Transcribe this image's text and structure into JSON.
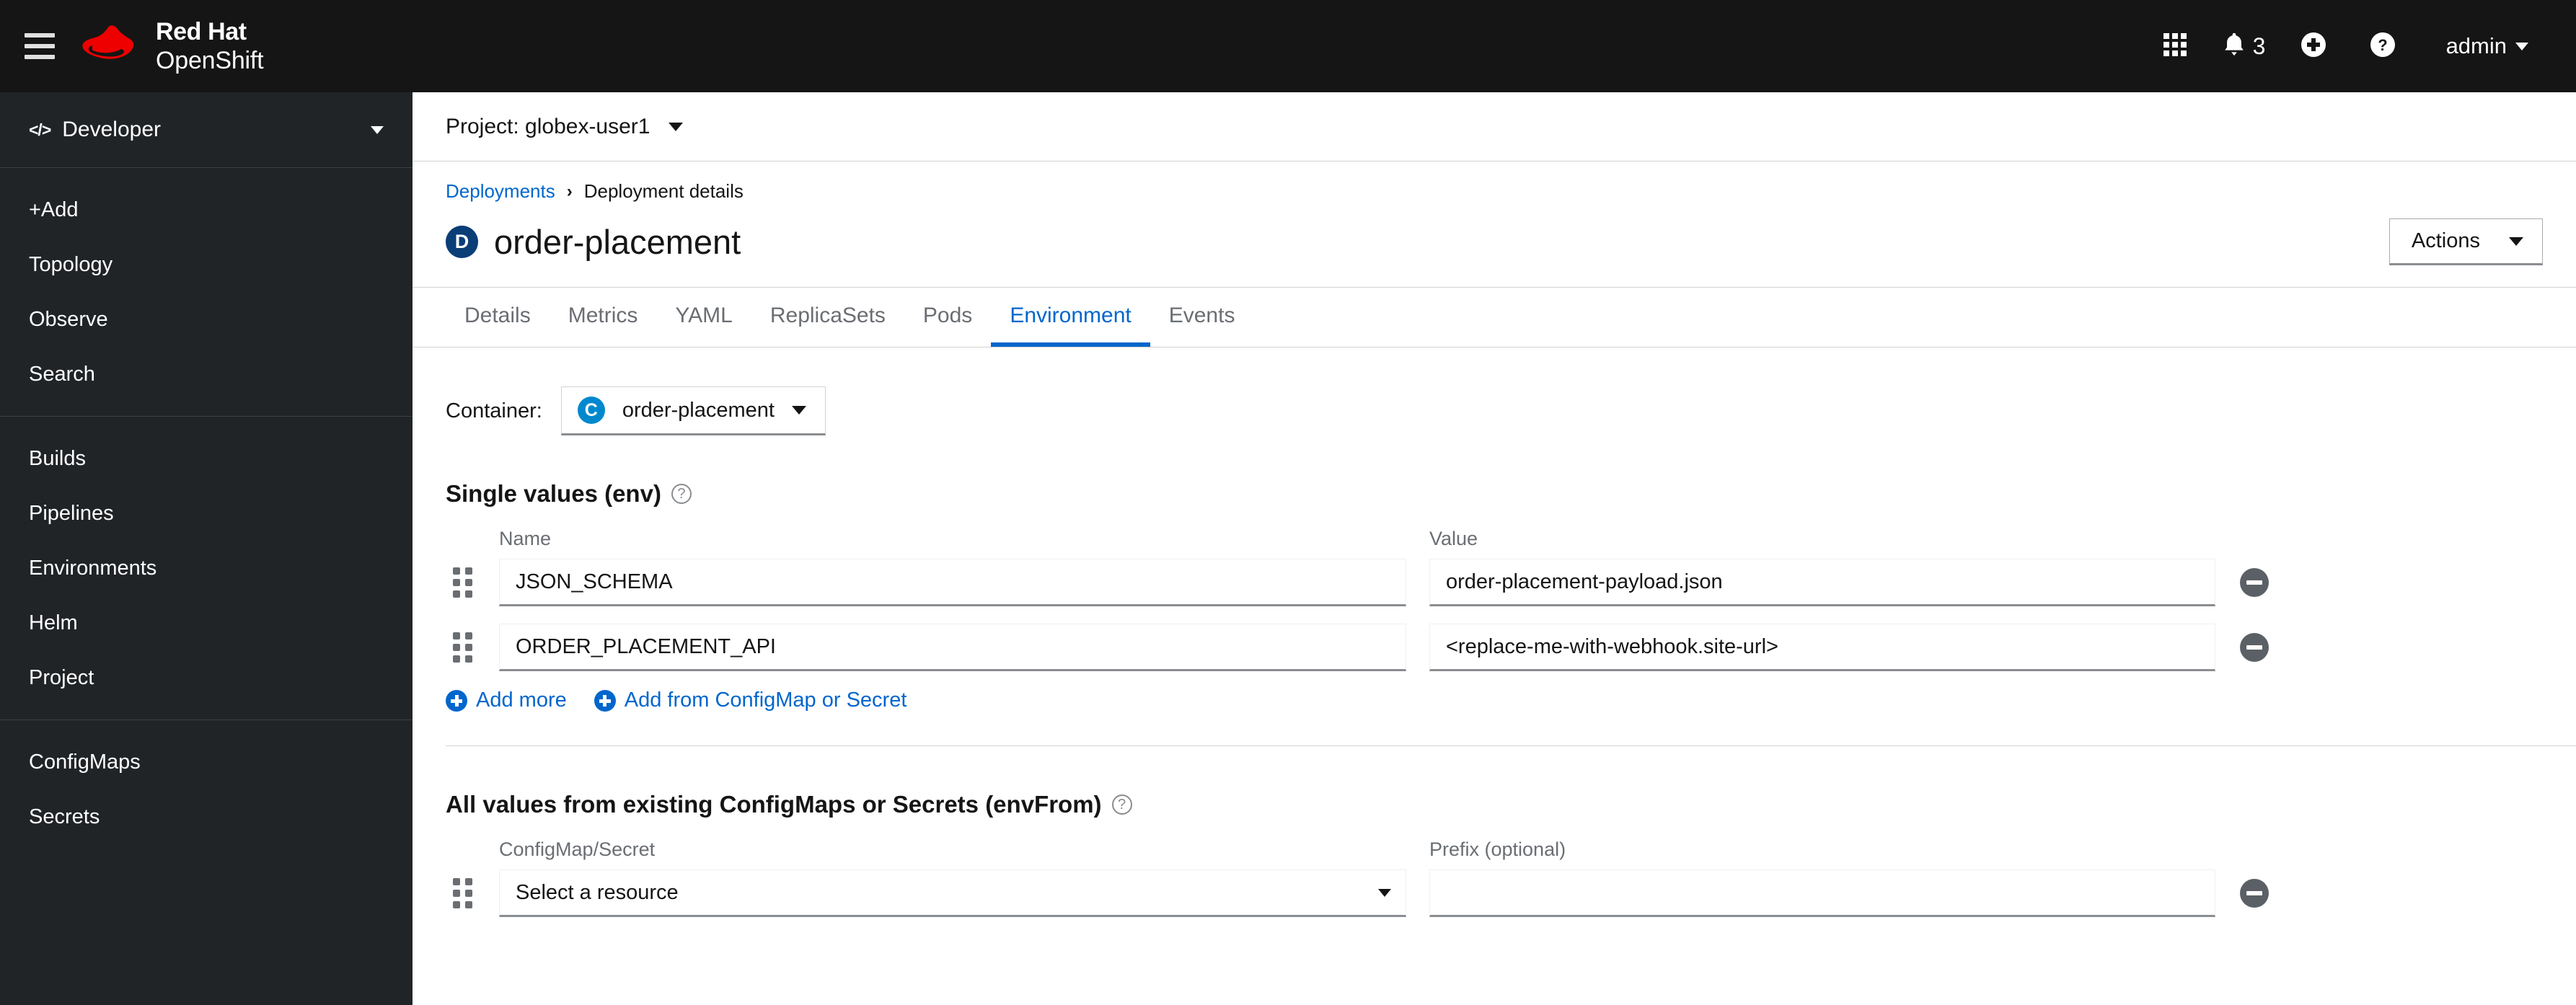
{
  "masthead": {
    "hamburger_name": "navigation-toggle",
    "brand_line1": "Red Hat",
    "brand_line2": "OpenShift",
    "app_launcher_icon": "grid-icon",
    "notification_icon": "bell-icon",
    "notification_count": "3",
    "add_icon": "plus-circle-icon",
    "help_icon": "question-circle-icon",
    "user_name": "admin"
  },
  "sidebar": {
    "perspective": {
      "icon": "code-icon",
      "label": "Developer"
    },
    "groups": [
      {
        "items": [
          {
            "label": "+Add"
          },
          {
            "label": "Topology"
          },
          {
            "label": "Observe"
          },
          {
            "label": "Search"
          }
        ]
      },
      {
        "items": [
          {
            "label": "Builds"
          },
          {
            "label": "Pipelines"
          },
          {
            "label": "Environments"
          },
          {
            "label": "Helm"
          },
          {
            "label": "Project"
          }
        ]
      },
      {
        "items": [
          {
            "label": "ConfigMaps"
          },
          {
            "label": "Secrets"
          }
        ]
      }
    ]
  },
  "project_bar": {
    "label": "Project: globex-user1"
  },
  "breadcrumb": {
    "parent": "Deployments",
    "separator": "›",
    "current": "Deployment details"
  },
  "page": {
    "badge": "D",
    "title": "order-placement",
    "actions_label": "Actions"
  },
  "tabs": [
    {
      "label": "Details",
      "active": false
    },
    {
      "label": "Metrics",
      "active": false
    },
    {
      "label": "YAML",
      "active": false
    },
    {
      "label": "ReplicaSets",
      "active": false
    },
    {
      "label": "Pods",
      "active": false
    },
    {
      "label": "Environment",
      "active": true
    },
    {
      "label": "Events",
      "active": false
    }
  ],
  "container": {
    "label": "Container:",
    "badge": "C",
    "name": "order-placement"
  },
  "single_values": {
    "title": "Single values (env)",
    "help_icon": "question-mark-icon",
    "col_name": "Name",
    "col_value": "Value",
    "rows": [
      {
        "name": "JSON_SCHEMA",
        "value": "order-placement-payload.json"
      },
      {
        "name": "ORDER_PLACEMENT_API",
        "value": "<replace-me-with-webhook.site-url>"
      }
    ],
    "add_more": "Add more",
    "add_from_configmap": "Add from ConfigMap or Secret"
  },
  "env_from": {
    "title": "All values from existing ConfigMaps or Secrets (envFrom)",
    "help_icon": "question-mark-icon",
    "col_resource": "ConfigMap/Secret",
    "col_prefix": "Prefix (optional)",
    "rows": [
      {
        "resource": "Select a resource",
        "prefix": ""
      }
    ]
  },
  "colors": {
    "masthead_bg": "#151515",
    "sidebar_bg": "#212427",
    "link_blue": "#0066cc",
    "active_tab": "#0066cc",
    "deployment_badge": "#0b3d77",
    "container_badge": "#0088ce",
    "red_hat_red": "#ee0000"
  }
}
